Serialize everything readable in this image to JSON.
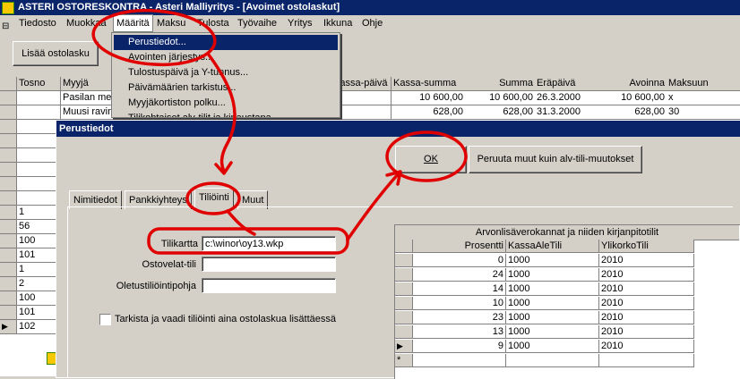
{
  "window": {
    "title": "ASTERI OSTORESKONTRA - Asteri Malliyritys - [Avoimet ostolaskut]"
  },
  "menubar": {
    "items": [
      {
        "label": "Tiedosto"
      },
      {
        "label": "Muokkaa"
      },
      {
        "label": "Määritä"
      },
      {
        "label": "Maksu"
      },
      {
        "label": "Tulosta"
      },
      {
        "label": "Työvaihe"
      },
      {
        "label": "Yritys"
      },
      {
        "label": "Ikkuna"
      },
      {
        "label": "Ohje"
      }
    ]
  },
  "toolbar": {
    "add_label": "Lisää ostolasku"
  },
  "dropdown": {
    "items": [
      {
        "label": "Perustiedot..."
      },
      {
        "label": "Avointen järjestys..."
      },
      {
        "label": "Tulostuspäivä ja Y-tunnus..."
      },
      {
        "label": "Päivämäärien tarkistus..."
      },
      {
        "label": "Myyjäkortiston polku..."
      },
      {
        "label": "Tilikohtaiset alv-tilit ja kirjaustapa..."
      }
    ]
  },
  "main_table": {
    "headers": {
      "tosno": "Tosno",
      "myyja": "Myyjä",
      "kassapaiva": "Kassa-päivä",
      "kassasumma": "Kassa-summa",
      "summa": "Summa",
      "erapaiva": "Eräpäivä",
      "avoinna": "Avoinna",
      "maksuun": "Maksuun"
    },
    "rows": [
      {
        "tosno": "",
        "myyja": "Pasilan mes",
        "kassasumma": "10 600,00",
        "summa": "10 600,00",
        "erapaiva": "26.3.2000",
        "avoinna": "10 600,00",
        "maksuun": "x"
      },
      {
        "tosno": "",
        "myyja": "Muusi ravin",
        "kassasumma": "628,00",
        "summa": "628,00",
        "erapaiva": "31.3.2000",
        "avoinna": "628,00",
        "maksuun": "30"
      }
    ],
    "tosno_left": [
      "",
      "",
      "",
      "",
      "",
      "",
      "1",
      "56",
      "100",
      "101",
      "1",
      "2",
      "100",
      "101",
      "102"
    ]
  },
  "dialog": {
    "title": "Perustiedot",
    "ok_label": "OK",
    "cancel_label": "Peruuta muut kuin alv-tili-muutokset",
    "tabs": [
      {
        "label": "Nimitiedot"
      },
      {
        "label": "Pankkiyhteys"
      },
      {
        "label": "Tiliöinti"
      },
      {
        "label": "Muut"
      }
    ],
    "fields": {
      "tilikartta_label": "Tilikartta",
      "tilikartta_value": "c:\\winor\\oy13.wkp",
      "ostovelat_label": "Ostovelat-tili",
      "ostovelat_value": "",
      "oletus_label": "Oletustiliöintipohja",
      "oletus_value": ""
    },
    "checkbox_label": "Tarkista ja vaadi tiliöinti aina ostolaskua lisättäessä",
    "checkbox_checked": false,
    "vat_table": {
      "caption": "Arvonlisäverokannat ja niiden kirjanpitotilit",
      "headers": [
        "Prosentti",
        "KassaAleTili",
        "YlikorkoTili"
      ],
      "rows": [
        {
          "prosentti": "0",
          "kassaale": "1000",
          "ylikorko": "2010"
        },
        {
          "prosentti": "24",
          "kassaale": "1000",
          "ylikorko": "2010"
        },
        {
          "prosentti": "14",
          "kassaale": "1000",
          "ylikorko": "2010"
        },
        {
          "prosentti": "10",
          "kassaale": "1000",
          "ylikorko": "2010"
        },
        {
          "prosentti": "23",
          "kassaale": "1000",
          "ylikorko": "2010"
        },
        {
          "prosentti": "13",
          "kassaale": "1000",
          "ylikorko": "2010"
        },
        {
          "prosentti": "9",
          "kassaale": "1000",
          "ylikorko": "2010"
        }
      ],
      "new_row_marker": "*",
      "current_marker": "▶"
    }
  },
  "colors": {
    "annotation": "#e00000",
    "titlebar": "#0a246a",
    "face": "#d4d0c8"
  }
}
